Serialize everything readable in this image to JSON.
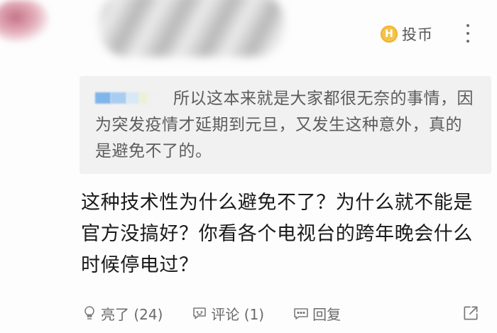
{
  "header": {
    "coin_icon_letter": "H",
    "coin_label": "投币",
    "more_icon": "more-vertical-icon"
  },
  "quote": {
    "text": "所以这本来就是大家都很无奈的事情，因为突发疫情才延期到元旦，又发生这种意外，真的是避免不了的。"
  },
  "comment": {
    "text": "这种技术性为什么避免不了？为什么就不能是官方没搞好？你看各个电视台的跨年晚会什么时候停电过？"
  },
  "actions": {
    "like_label": "亮了 (24)",
    "comment_label": "评论 (1)",
    "reply_label": "回复",
    "like_icon": "lightbulb-icon",
    "comment_icon": "comment-bubble-icon",
    "reply_icon": "reply-bubble-icon",
    "share_icon": "share-icon"
  },
  "colors": {
    "coin_accent": "#f4c34a",
    "quote_bg": "#f1f1f2",
    "action_text": "#6a6a6a"
  }
}
